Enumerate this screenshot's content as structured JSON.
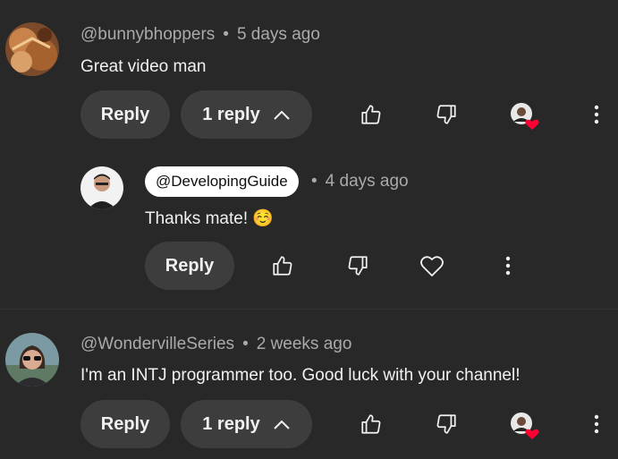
{
  "comments": [
    {
      "author": "@bunnybhoppers",
      "time": "5 days ago",
      "text": "Great video man",
      "reply_label": "Reply",
      "replies_label": "1 reply"
    },
    {
      "author": "@DevelopingGuide",
      "time": "4 days ago",
      "text": "Thanks mate! ☺️",
      "reply_label": "Reply"
    },
    {
      "author": "@WondervilleSeries",
      "time": "2 weeks ago",
      "text": "I'm an INTJ programmer too. Good luck with your channel!",
      "reply_label": "Reply",
      "replies_label": "1 reply"
    }
  ],
  "colors": {
    "background": "#282828",
    "button": "#3d3d3d",
    "heart": "#ff0033",
    "meta": "#aaaaaa"
  },
  "icons": [
    "like-icon",
    "dislike-icon",
    "heart-icon",
    "more-vert-icon",
    "chevron-up-icon",
    "creator-heart-icon"
  ]
}
